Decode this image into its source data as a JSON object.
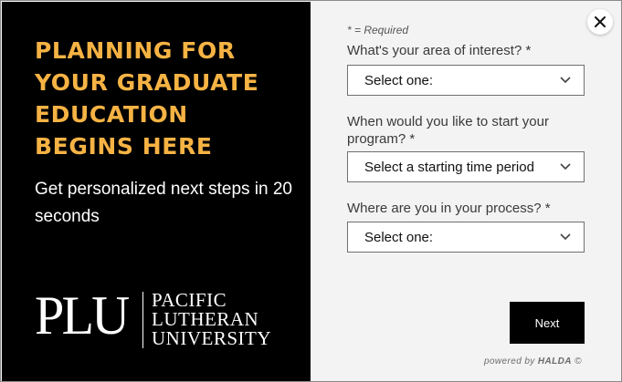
{
  "promo": {
    "headline_lines": [
      "PLANNING FOR",
      "YOUR GRADUATE",
      "EDUCATION",
      "BEGINS HERE"
    ],
    "subtext": "Get personalized next steps in 20 seconds",
    "accent_color": "#f6b344",
    "logo": {
      "mark": "PLU",
      "name_lines": [
        "PACIFIC",
        "LUTHERAN",
        "UNIVERSITY"
      ]
    }
  },
  "form": {
    "required_note": "* = Required",
    "fields": [
      {
        "label": "What's your area of interest? *",
        "value": "Select one:"
      },
      {
        "label": "When would you like to start your program? *",
        "value": "Select a starting time period"
      },
      {
        "label": "Where are you in your process? *",
        "value": "Select one:"
      }
    ],
    "next_label": "Next",
    "powered_prefix": "powered by",
    "powered_brand": "HALDA",
    "powered_suffix": "©"
  },
  "icons": {
    "close": "close-icon",
    "chevron": "chevron-down-icon"
  }
}
